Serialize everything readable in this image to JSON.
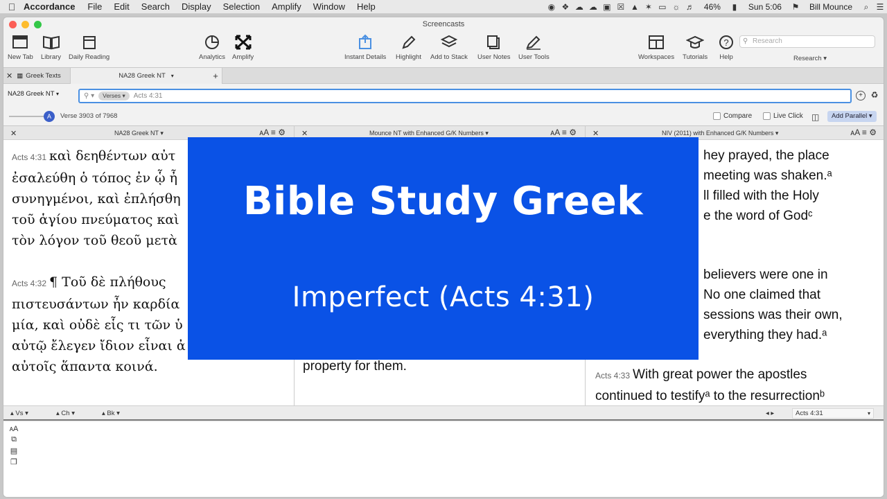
{
  "menubar": {
    "app": "Accordance",
    "menus": [
      "File",
      "Edit",
      "Search",
      "Display",
      "Selection",
      "Amplify",
      "Window",
      "Help"
    ],
    "battery": "46%",
    "clock": "Sun 5:06",
    "user": "Bill Mounce"
  },
  "window": {
    "title": "Screencasts"
  },
  "toolbar": {
    "new_tab": "New Tab",
    "library": "Library",
    "daily_reading": "Daily Reading",
    "analytics": "Analytics",
    "amplify": "Amplify",
    "instant_details": "Instant Details",
    "highlight": "Highlight",
    "add_to_stack": "Add to Stack",
    "user_notes": "User Notes",
    "user_tools": "User Tools",
    "workspaces": "Workspaces",
    "tutorials": "Tutorials",
    "help": "Help",
    "research_placeholder": "Research",
    "research_label": "Research ▾"
  },
  "tabs": {
    "group": "Greek Texts",
    "active": "NA28 Greek NT",
    "add": "+"
  },
  "search": {
    "text": "NA28 Greek NT",
    "mode": "Verses",
    "query": "Acts 4:31"
  },
  "slider": {
    "verse_count": "Verse 3903 of 7968",
    "compare": "Compare",
    "live_click": "Live Click",
    "add_parallel": "Add Parallel"
  },
  "panes": [
    {
      "name": "NA28 Greek NT",
      "v1_ref": "Acts 4:31",
      "v1_lines": [
        "καὶ δεηθέντων αὐτ",
        "ἐσαλεύθη ὁ τόπος ἐν ᾧ ἦ",
        "συνηγμένοι, καὶ ἐπλήσθη",
        "τοῦ ἁγίου πνεύματος καὶ",
        "τὸν λόγον τοῦ θεοῦ μετὰ"
      ],
      "v2_ref": "Acts 4:32",
      "v2_lines": [
        "¶  Τοῦ δὲ πλήθους",
        "πιστευσάντων ἦν καρδία",
        "μία, καὶ οὐδὲ εἷς τι τῶν ὑ",
        "αὐτῷ ἔλεγεν ἴδιον εἶναι ἀ",
        "αὐτοῖς ἅπαντα κοινά."
      ]
    },
    {
      "name": "Mounce NT with Enhanced G/K Numbers",
      "line": "property for them."
    },
    {
      "name": "NIV (2011) with Enhanced G/K Numbers",
      "v1_lines": [
        "hey prayed, the place",
        "meeting was shaken.ᵃ",
        "ll filled with the Holy",
        "e the word of Godᶜ"
      ],
      "v2_lines": [
        "believers were one in",
        "No one claimed that",
        "sessions was their own,",
        "everything they had.ᵃ"
      ],
      "v3_ref": "Acts 4:33",
      "v3_lines": [
        "With great power the apostles",
        "continued to testifyᵃ to the resurrectionᵇ"
      ]
    }
  ],
  "nav": {
    "vs": "Vs",
    "ch": "Ch",
    "bk": "Bk",
    "reference": "Acts 4:31"
  },
  "overlay": {
    "title": "Bible Study Greek",
    "subtitle": "Imperfect (Acts 4:31)"
  }
}
